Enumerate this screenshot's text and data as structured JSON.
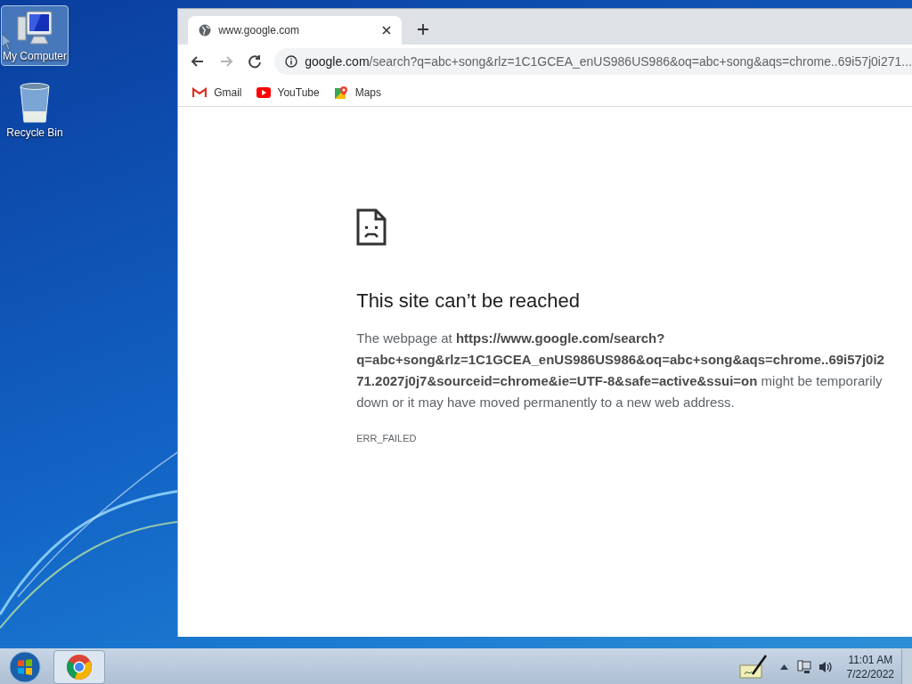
{
  "desktop_icons": [
    {
      "kind": "computer",
      "label": "My Computer",
      "selected": true
    },
    {
      "kind": "recycle-bin",
      "label": "Recycle Bin",
      "selected": false
    }
  ],
  "browser": {
    "tab": {
      "title": "www.google.com"
    },
    "nav_buttons": [
      {
        "kind": "back",
        "disabled": false
      },
      {
        "kind": "forward",
        "disabled": true
      },
      {
        "kind": "reload",
        "disabled": false
      }
    ],
    "address": {
      "host": "google.com",
      "path": "/search?q=abc+song&rlz=1C1GCEA_enUS986US986&oq=abc+song&aqs=chrome..69i57j0i271..."
    },
    "bookmarks": [
      {
        "kind": "gmail",
        "label": "Gmail"
      },
      {
        "kind": "youtube",
        "label": "YouTube"
      },
      {
        "kind": "maps",
        "label": "Maps"
      }
    ],
    "error": {
      "title": "This site can’t be reached",
      "message": "The webpage at **https://www.google.com/search?q=abc+song&rlz=1C1GCEA_enUS986US986&oq=abc+song&aqs=chrome..69i57j0i271.2027j0j7&sourceid=chrome&ie=UTF-8&safe=active&ssui=on** might be temporarily down or it may have moved permanently to a new web address.",
      "code": "ERR_FAILED"
    }
  },
  "taskbar": {
    "clock_time": "11:01 AM",
    "clock_date": "7/22/2022"
  }
}
